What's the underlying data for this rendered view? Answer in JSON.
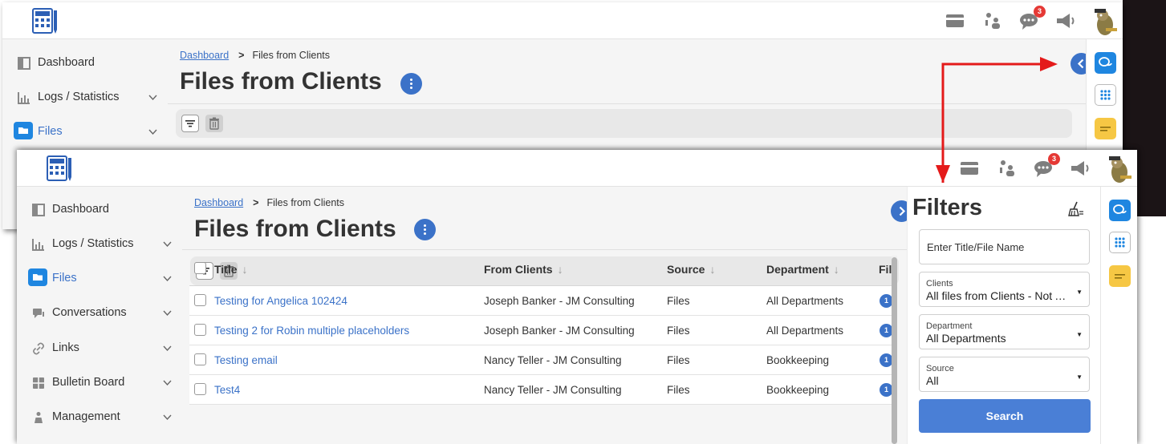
{
  "app": {
    "colors": {
      "accent": "#3b72c8",
      "sidebar_bg": "#f5f5f5",
      "badge": "#e53935",
      "search_button": "#4a7fd6",
      "annotation_arrow": "#e41a1a"
    },
    "topbar": {
      "notification_count": "3"
    },
    "sidebar": {
      "items": [
        {
          "label": "Dashboard",
          "icon": "dashboard-icon"
        },
        {
          "label": "Logs / Statistics",
          "icon": "chart-icon"
        },
        {
          "label": "Files",
          "icon": "folder-icon"
        },
        {
          "label": "Conversations",
          "icon": "chat-icon"
        },
        {
          "label": "Links",
          "icon": "link-icon"
        },
        {
          "label": "Bulletin Board",
          "icon": "grid-icon"
        },
        {
          "label": "Management",
          "icon": "person-icon"
        }
      ]
    },
    "breadcrumb": {
      "home": "Dashboard",
      "current": "Files from Clients"
    },
    "page_title": "Files from Clients",
    "table": {
      "columns": [
        "Title",
        "From Clients",
        "Source",
        "Department",
        "File"
      ],
      "sort_arrow": "↓",
      "rows": [
        {
          "title": "Testing for Angelica 102424",
          "from": "Joseph Banker - JM Consulting",
          "source": "Files",
          "department": "All Departments",
          "count": "1"
        },
        {
          "title": "Testing 2 for Robin multiple placeholders",
          "from": "Joseph Banker - JM Consulting",
          "source": "Files",
          "department": "All Departments",
          "count": "1"
        },
        {
          "title": "Testing email",
          "from": "Nancy Teller - JM Consulting",
          "source": "Files",
          "department": "Bookkeeping",
          "count": "1"
        },
        {
          "title": "Test4",
          "from": "Nancy Teller - JM Consulting",
          "source": "Files",
          "department": "Bookkeeping",
          "count": "1"
        }
      ]
    },
    "filters": {
      "title": "Filters",
      "title_placeholder": "Enter Title/File Name",
      "clients_label": "Clients",
      "clients_value": "All files from Clients - Not Ac...",
      "department_label": "Department",
      "department_value": "All Departments",
      "source_label": "Source",
      "source_value": "All",
      "search_label": "Search"
    }
  }
}
